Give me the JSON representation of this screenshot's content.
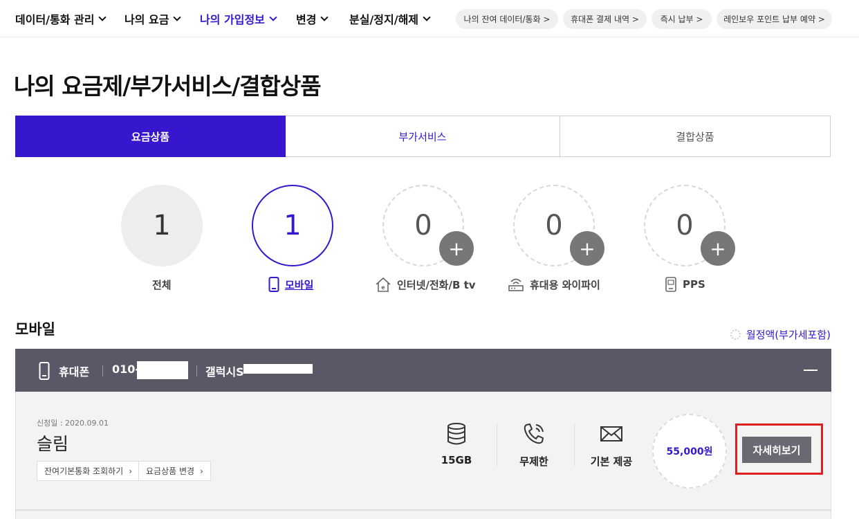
{
  "nav": {
    "items": [
      {
        "label": "데이터/통화 관리"
      },
      {
        "label": "나의 요금"
      },
      {
        "label": "나의 가입정보"
      },
      {
        "label": "변경"
      },
      {
        "label": "분실/정지/해제"
      }
    ],
    "quick_links": [
      "나의 잔여 데이터/통화 >",
      "휴대폰 결제 내역 >",
      "즉시 납부 >",
      "레인보우 포인트 납부 예약 >"
    ]
  },
  "page_title": "나의 요금제/부가서비스/결합상품",
  "tabs": [
    "요금상품",
    "부가서비스",
    "결합상품"
  ],
  "categories": [
    {
      "count": "1",
      "label": "전체"
    },
    {
      "count": "1",
      "label": "모바일"
    },
    {
      "count": "0",
      "label": "인터넷/전화/B tv"
    },
    {
      "count": "0",
      "label": "휴대용 와이파이"
    },
    {
      "count": "0",
      "label": "PPS"
    }
  ],
  "plus_symbol": "+",
  "section": {
    "title": "모바일",
    "monthly_label": "월정액(부가세포함)"
  },
  "device": {
    "type": "휴대폰",
    "number_prefix": "010-",
    "model_prefix": "갤럭시S"
  },
  "plan": {
    "applied_date": "신청일 : 2020.09.01",
    "name": "슬림",
    "buttons": [
      "잔여기본통화 조회하기",
      "요금상품 변경"
    ],
    "features": [
      {
        "icon": "database-icon",
        "label": "15GB"
      },
      {
        "icon": "phone-call-icon",
        "label": "무제한"
      },
      {
        "icon": "envelope-icon",
        "label": "기본 제공"
      }
    ],
    "price": "55,000원",
    "detail_button": "자세히보기"
  },
  "colors": {
    "brand": "#3617ce",
    "dark_bar": "#5a5767",
    "highlight": "#e11d1d"
  }
}
